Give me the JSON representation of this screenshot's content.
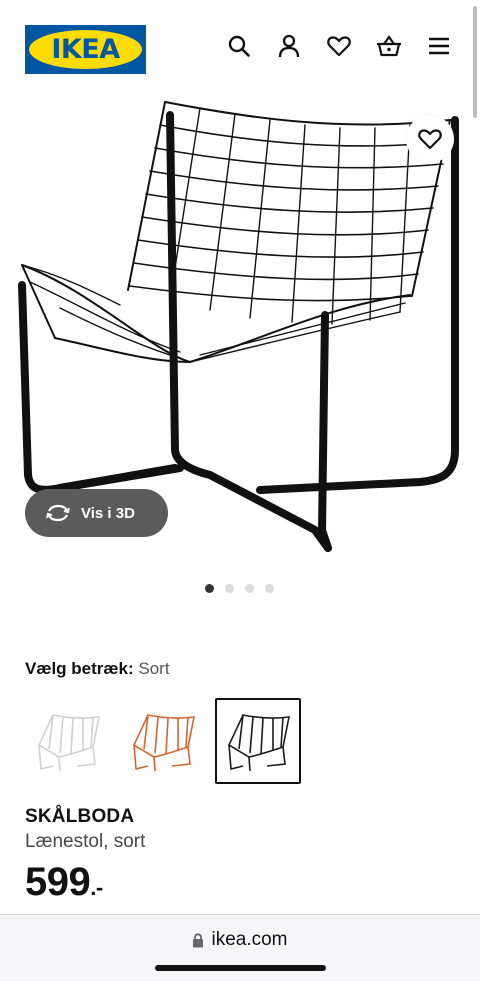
{
  "header": {
    "logo_text": "IKEA",
    "icons": [
      "search-icon",
      "user-icon",
      "heart-icon",
      "basket-icon",
      "menu-icon"
    ]
  },
  "gallery": {
    "view_3d_label": "Vis i 3D",
    "dot_count": 4,
    "active_dot": 1
  },
  "variant": {
    "label": "Vælg betræk:",
    "value": "Sort",
    "options": [
      {
        "name": "Hvid",
        "color": "#d9d9d9"
      },
      {
        "name": "Orange",
        "color": "#d9622b"
      },
      {
        "name": "Sort",
        "color": "#1a1a1a",
        "selected": true
      }
    ]
  },
  "product": {
    "name": "SKÅLBODA",
    "description": "Lænestol, sort",
    "price": "599",
    "price_suffix": ".-"
  },
  "browser": {
    "url": "ikea.com"
  },
  "colors": {
    "ikea_blue": "#0058a3",
    "ikea_yellow": "#ffdb00"
  }
}
